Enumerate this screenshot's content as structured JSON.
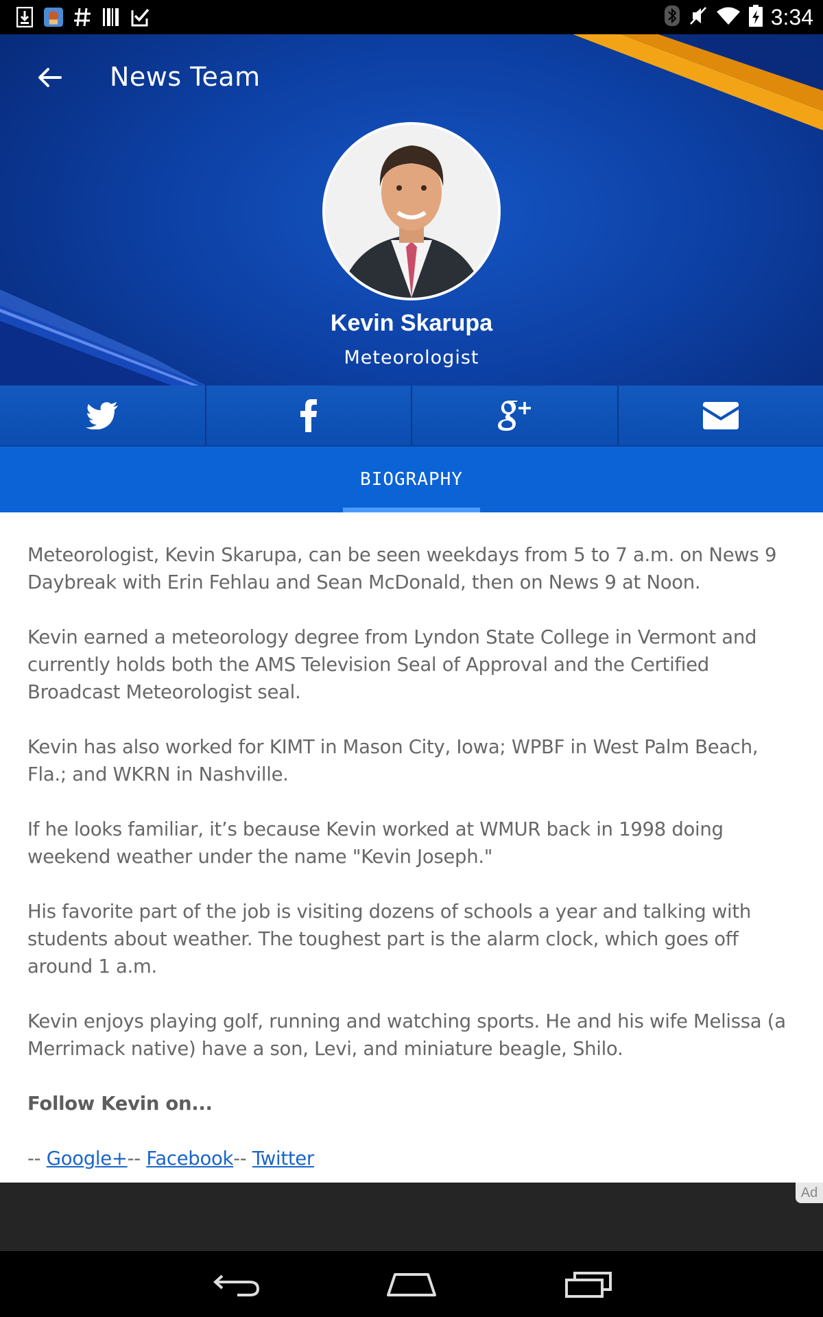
{
  "status_bar": {
    "time": "3:34",
    "left_icons": [
      "download-icon",
      "app-notification-icon",
      "hash-icon",
      "barcode-icon",
      "clipboard-check-icon"
    ],
    "right_icons": [
      "bluetooth-icon",
      "muted-icon",
      "wifi-icon",
      "battery-charging-icon"
    ]
  },
  "header": {
    "title": "News Team",
    "back_icon": "arrow-back-icon",
    "name": "Kevin Skarupa",
    "role": "Meteorologist",
    "colors": {
      "primary": "#0c63d6",
      "dark": "#06246e",
      "accent": "#f3a416"
    }
  },
  "social": [
    {
      "icon": "twitter-icon"
    },
    {
      "icon": "facebook-icon"
    },
    {
      "icon": "google-plus-icon"
    },
    {
      "icon": "email-icon"
    }
  ],
  "tabs": [
    {
      "label": "BIOGRAPHY",
      "active": true
    }
  ],
  "bio": {
    "paragraphs": [
      "Meteorologist, Kevin Skarupa, can be seen weekdays from 5 to 7 a.m. on News 9 Daybreak with Erin Fehlau and Sean McDonald, then on News 9 at Noon.",
      "Kevin earned a meteorology degree from Lyndon State College in Vermont and currently holds both the AMS Television Seal of Approval and the Certified Broadcast Meteorologist seal.",
      "Kevin has also worked for KIMT in Mason City, Iowa; WPBF in West Palm Beach, Fla.; and WKRN in Nashville.",
      "If he looks familiar, it’s because Kevin worked at WMUR back in 1998 doing weekend weather under the name \"Kevin Joseph.\"",
      "His favorite part of the job is visiting dozens of schools a year and talking with students about weather. The toughest part is the alarm clock, which goes off around 1 a.m.",
      "Kevin enjoys playing golf, running and watching sports. He and his wife Melissa (a Merrimack native) have a son, Levi, and miniature beagle, Shilo."
    ],
    "follow_heading": "Follow Kevin on...",
    "links_prefix": "-- ",
    "links_separator": "-- ",
    "links": [
      "Google+",
      "Facebook",
      "Twitter"
    ]
  },
  "ad": {
    "label": "Ad"
  },
  "nav": [
    "back-nav-icon",
    "home-nav-icon",
    "recents-nav-icon"
  ]
}
